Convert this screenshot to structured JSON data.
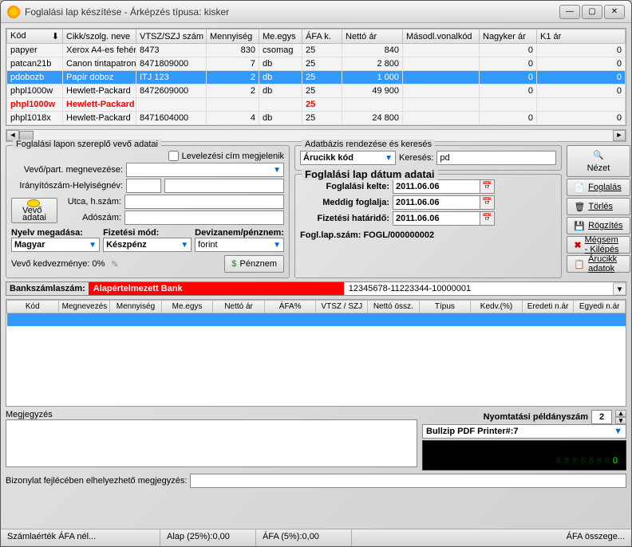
{
  "window": {
    "title": "Foglalási lap készítése - Árképzés típusa: kisker"
  },
  "top_table": {
    "headers": [
      "Kód",
      "Cikk/szolg. neve",
      "VTSZ/SZJ szám",
      "Mennyiség",
      "Me.egys",
      "ÁFA k.",
      "Nettó ár",
      "Másodl.vonalkód",
      "Nagyker ár",
      "K1 ár"
    ],
    "rows": [
      {
        "cells": [
          "papyer",
          "Xerox A4-es fehér",
          "8473",
          "830",
          "csomag",
          "25",
          "840",
          "",
          "0",
          "0"
        ]
      },
      {
        "cells": [
          "patcan21b",
          "Canon tintapatron",
          "8471809000",
          "7",
          "db",
          "25",
          "2 800",
          "",
          "0",
          "0"
        ]
      },
      {
        "cells": [
          "pdobozb",
          "Papír doboz",
          "ITJ 123",
          "2",
          "db",
          "25",
          "1 000",
          "",
          "0",
          "0"
        ],
        "selected": true
      },
      {
        "cells": [
          "phpl1000w",
          "Hewlett-Packard",
          "8472609000",
          "2",
          "db",
          "25",
          "49 900",
          "",
          "0",
          "0"
        ]
      },
      {
        "cells": [
          "phpl1000w",
          "Hewlett-Packard",
          "",
          "",
          "",
          "25",
          "",
          "",
          "",
          ""
        ],
        "red": true
      },
      {
        "cells": [
          "phpl1018x",
          "Hewlett-Packard",
          "8471604000",
          "4",
          "db",
          "25",
          "24 800",
          "",
          "0",
          "0"
        ]
      }
    ]
  },
  "customer_panel": {
    "legend": "Foglalási lapon szereplő vevő adatai",
    "chk_mail": "Levelezési cím megjelenik",
    "lbl_name": "Vevő/part. megnevezése:",
    "lbl_zip": "Irányítószám-Helyiségnév:",
    "lbl_street": "Utca, h.szám:",
    "lbl_tax": "Adószám:",
    "btn_vevo_line1": "Vevő",
    "btn_vevo_line2": "adatai",
    "lbl_lang": "Nyelv megadása:",
    "lbl_pay": "Fizetési mód:",
    "lbl_curr": "Devizanem/pénznem:",
    "val_lang": "Magyar",
    "val_pay": "Készpénz",
    "val_curr": "forint",
    "lbl_disc": "Vevő kedvezménye: 0%",
    "btn_penznem": "Pénznem"
  },
  "search_panel": {
    "legend": "Adatbázis rendezése és keresés",
    "combo_field": "Árucikk kód",
    "lbl_search": "Keresés:",
    "val_search": "pd"
  },
  "dates_panel": {
    "legend": "Foglalási lap dátum adatai",
    "lbl_created": "Foglalási kelte:",
    "lbl_until": "Meddig foglalja:",
    "lbl_due": "Fizetési határidő:",
    "val_created": "2011.06.06",
    "val_until": "2011.06.06",
    "val_due": "2011.06.06",
    "lbl_docnum": "Fogl.lap.szám: FOGL/000000002"
  },
  "right_buttons": {
    "nezet": "Nézet",
    "foglalas": "Foglalás",
    "torles": "Törlés",
    "rogzites": "Rögzítés",
    "megse": "Mégsem - Kilépés",
    "arucikk": "Árucikk adatok"
  },
  "bank": {
    "label": "Bankszámlaszám:",
    "name": "Alapértelmezett Bank",
    "number": "12345678-11223344-10000001"
  },
  "low_table": {
    "headers": [
      "Kód",
      "Megnevezés",
      "Mennyiség",
      "Me.egys",
      "Nettó ár",
      "ÁFA%",
      "VTSZ / SZJ",
      "Nettó össz.",
      "Típus",
      "Kedv.(%)",
      "Eredeti n.ár",
      "Egyedi n.ár"
    ]
  },
  "comment": {
    "label": "Megjegyzés",
    "val": ""
  },
  "printer": {
    "lbl_copies": "Nyomtatási példányszám",
    "val_copies": "2",
    "sel": "Bullzip PDF Printer#:7",
    "display": "0"
  },
  "bottom_comment": {
    "label": "Bizonylat fejlécében elhelyezhető megjegyzés:"
  },
  "status": {
    "c1": "Számlaérték ÁFA nél...",
    "c2": "Alap (25%):0,00",
    "c3": "ÁFA (5%):0,00",
    "c4": "ÁFA összege..."
  }
}
